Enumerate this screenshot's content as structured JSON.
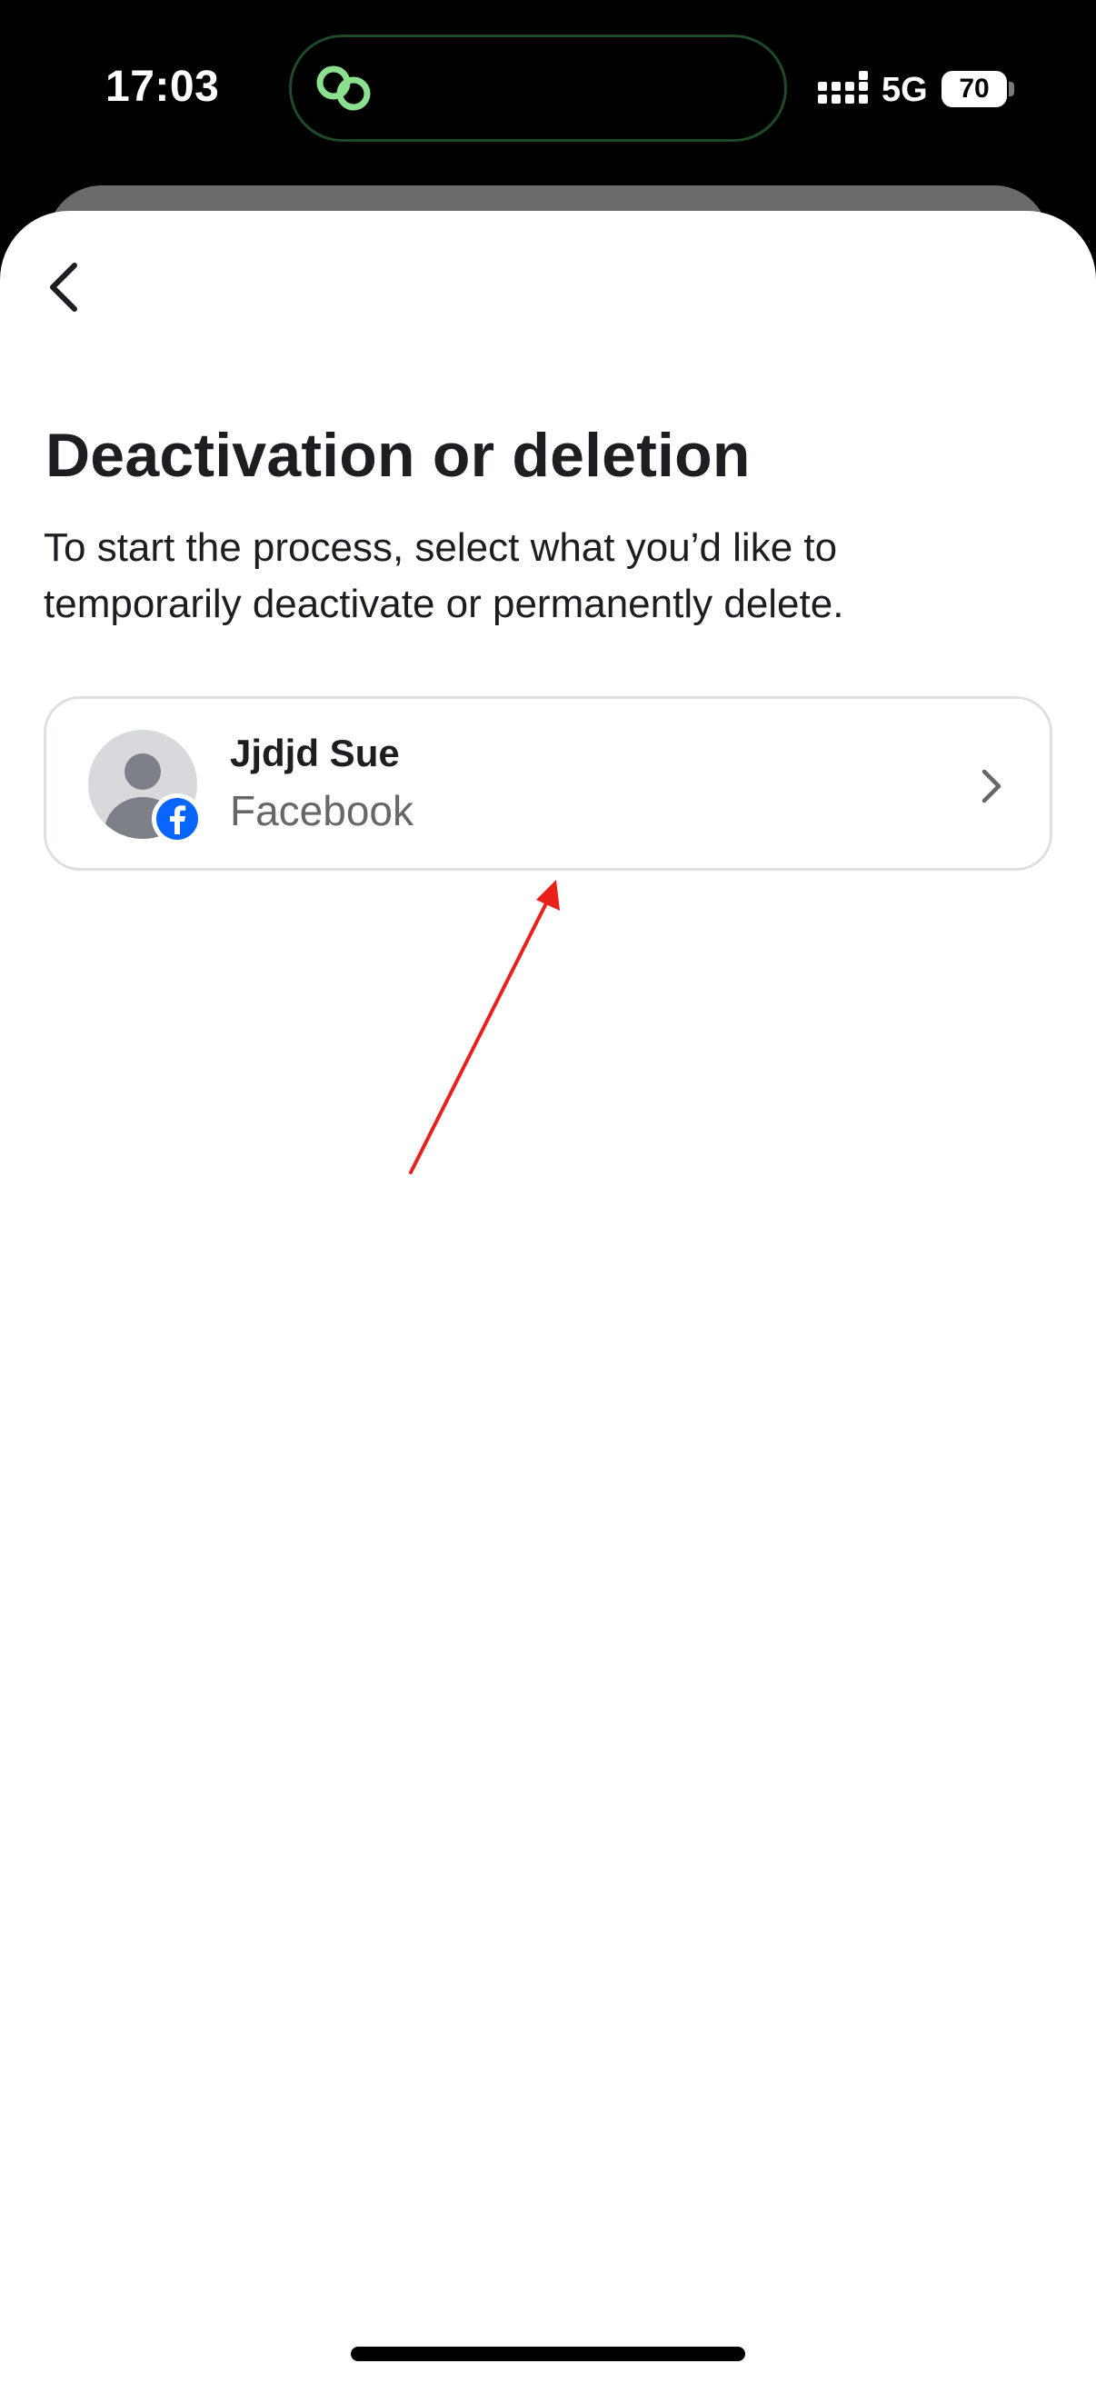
{
  "status_bar": {
    "time": "17:03",
    "network": "5G",
    "battery": "70",
    "island_icon": "link-icon",
    "signal_icon": "signal-bars-icon"
  },
  "page": {
    "title": "Deactivation or deletion",
    "description": "To start the process, select what you’d like to temporarily deactivate or permanently delete.",
    "back_icon": "chevron-left-icon"
  },
  "accounts": [
    {
      "name": "Jjdjd Sue",
      "platform": "Facebook",
      "avatar_icon": "default-avatar-icon",
      "badge_icon": "facebook-icon",
      "action_icon": "chevron-right-icon"
    }
  ],
  "colors": {
    "facebook_blue": "#0866ff",
    "island_accent": "#8be08f",
    "annotation_red": "#e8221b",
    "text_primary": "#1c1e21",
    "text_secondary": "#65676b",
    "card_border": "#dddfe2"
  }
}
